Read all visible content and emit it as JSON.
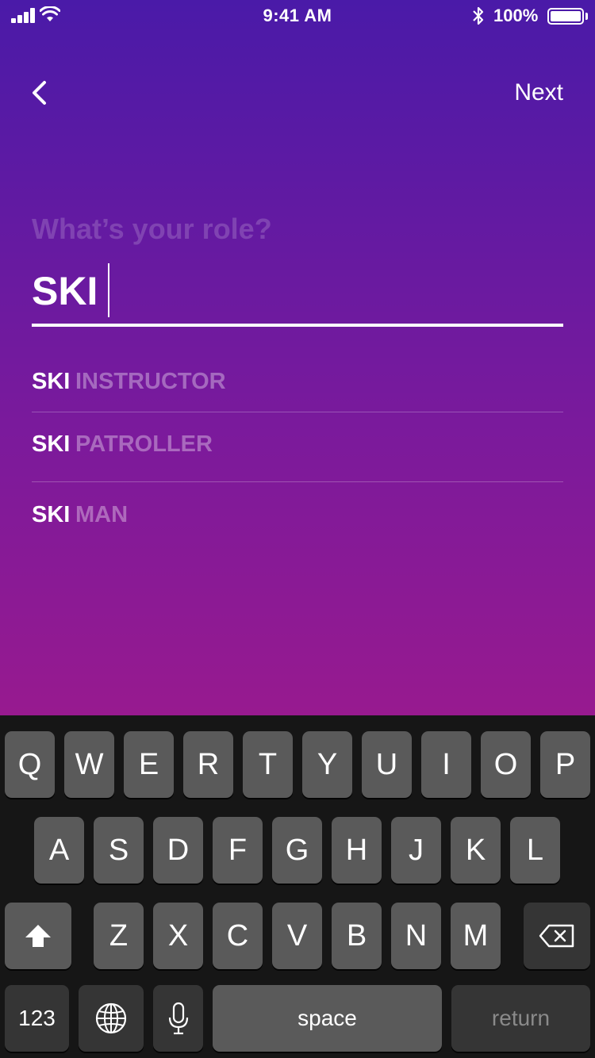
{
  "status_bar": {
    "time": "9:41 AM",
    "battery_percent": "100%",
    "battery_level": 1.0,
    "signal_bars": 4,
    "icons": [
      "signal-icon",
      "wifi-icon",
      "bluetooth-icon",
      "battery-icon"
    ]
  },
  "nav": {
    "back_icon": "chevron-left-icon",
    "next_label": "Next"
  },
  "form": {
    "prompt": "What’s your role?",
    "input_value": "SKI"
  },
  "suggestions": [
    {
      "match": "SKI",
      "rest": "INSTRUCTOR"
    },
    {
      "match": "SKI",
      "rest": "PATROLLER"
    },
    {
      "match": "SKI",
      "rest": "MAN"
    }
  ],
  "keyboard": {
    "row1": [
      "Q",
      "W",
      "E",
      "R",
      "T",
      "Y",
      "U",
      "I",
      "O",
      "P"
    ],
    "row2": [
      "A",
      "S",
      "D",
      "F",
      "G",
      "H",
      "J",
      "K",
      "L"
    ],
    "row3": [
      "Z",
      "X",
      "C",
      "V",
      "B",
      "N",
      "M"
    ],
    "shift_icon": "shift-icon",
    "delete_icon": "backspace-icon",
    "numbers_label": "123",
    "globe_icon": "globe-icon",
    "mic_icon": "microphone-icon",
    "space_label": "space",
    "return_label": "return"
  },
  "colors": {
    "gradient_top": "#4a1aa8",
    "gradient_bottom": "#b3127c",
    "keyboard_bg": "#161616",
    "key_bg": "#5a5a5a",
    "key_dark_bg": "#353535"
  }
}
